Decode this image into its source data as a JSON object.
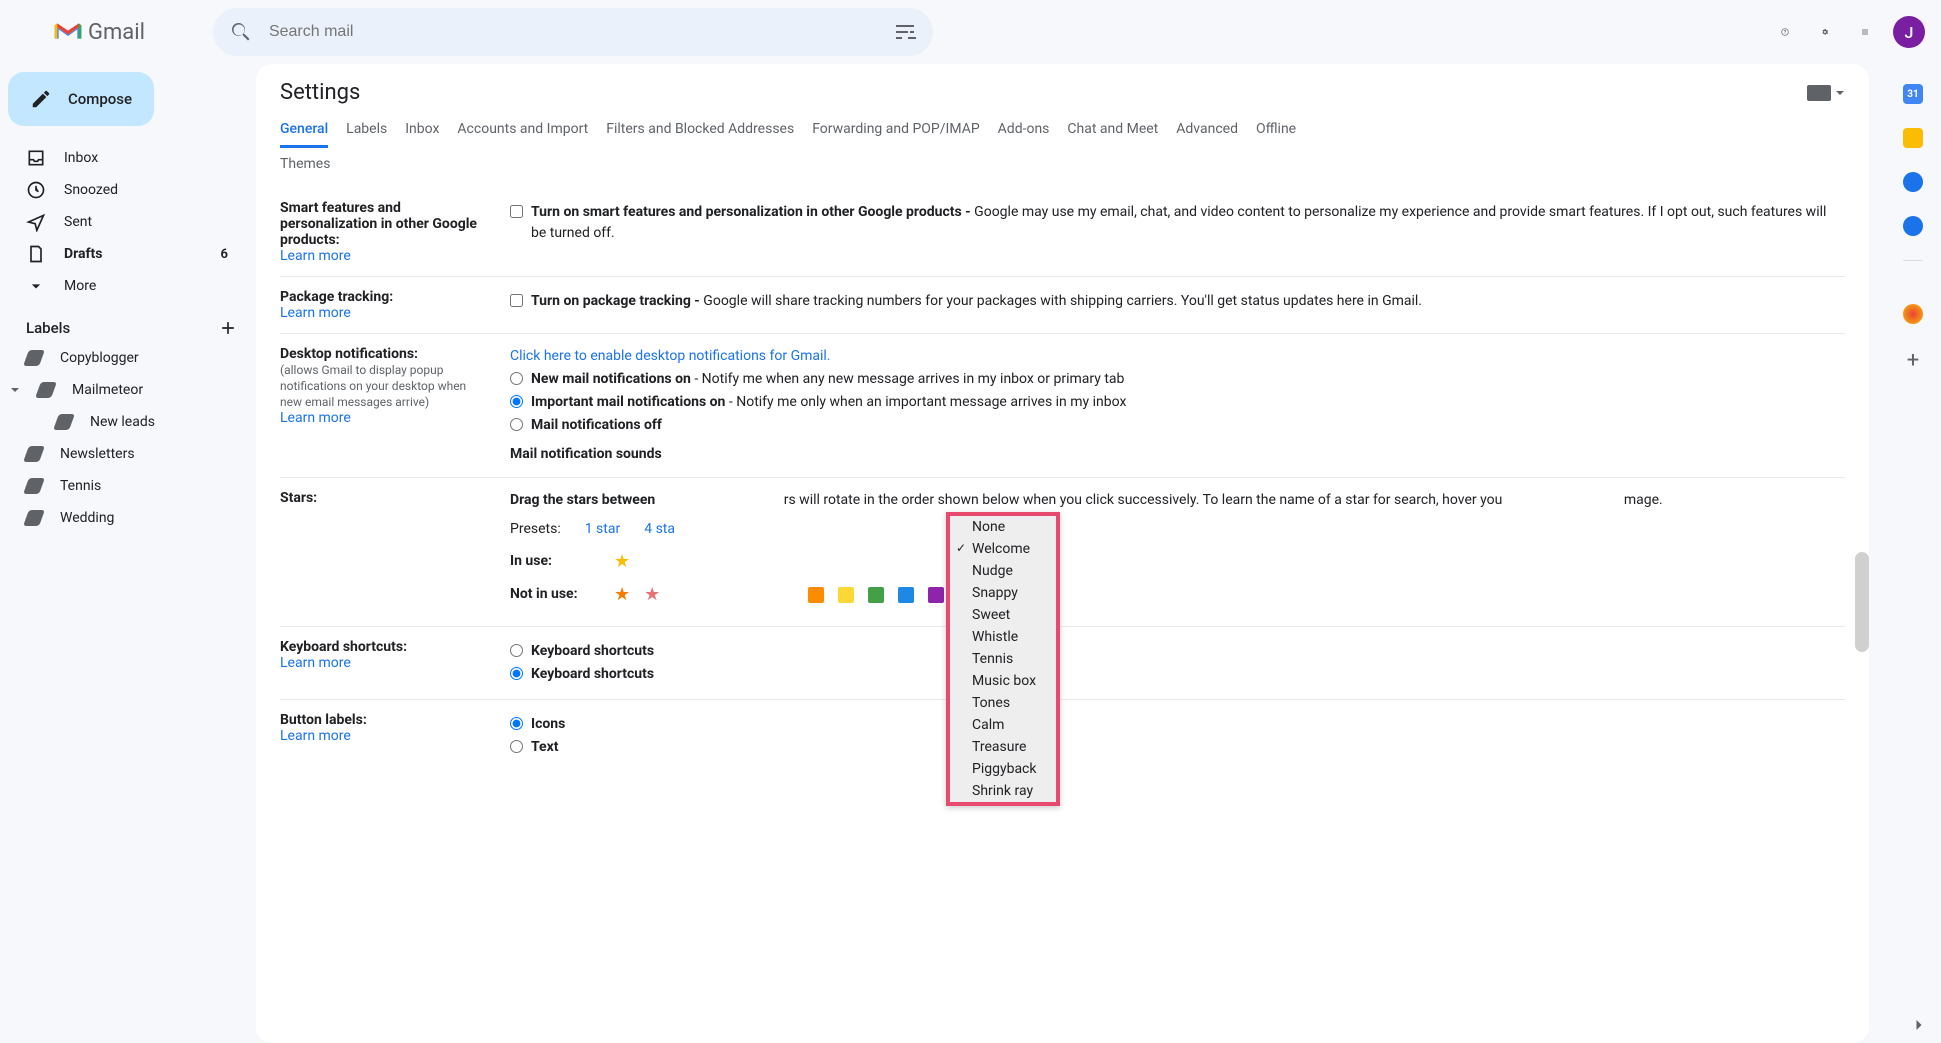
{
  "header": {
    "app_name": "Gmail",
    "search_placeholder": "Search mail",
    "avatar_initial": "J"
  },
  "sidebar": {
    "compose": "Compose",
    "nav": [
      {
        "label": "Inbox"
      },
      {
        "label": "Snoozed"
      },
      {
        "label": "Sent"
      },
      {
        "label": "Drafts",
        "count": "6",
        "bold": true
      },
      {
        "label": "More"
      }
    ],
    "labels_title": "Labels",
    "labels": [
      {
        "label": "Copyblogger"
      },
      {
        "label": "Mailmeteor",
        "caret": true
      },
      {
        "label": "New leads",
        "indent": true
      },
      {
        "label": "Newsletters"
      },
      {
        "label": "Tennis"
      },
      {
        "label": "Wedding"
      }
    ]
  },
  "settings": {
    "title": "Settings",
    "tabs": [
      "General",
      "Labels",
      "Inbox",
      "Accounts and Import",
      "Filters and Blocked Addresses",
      "Forwarding and POP/IMAP",
      "Add-ons",
      "Chat and Meet",
      "Advanced",
      "Offline"
    ],
    "tabs_row2": [
      "Themes"
    ],
    "active_tab": "General",
    "rows": {
      "smart": {
        "title": "Smart features and personalization in other Google products:",
        "learn": "Learn more",
        "bold": "Turn on smart features and personalization in other Google products - ",
        "text": "Google may use my email, chat, and video content to personalize my experience and provide smart features. If I opt out, such features will be turned off."
      },
      "package": {
        "title": "Package tracking:",
        "learn": "Learn more",
        "bold": "Turn on package tracking - ",
        "text": "Google will share tracking numbers for your packages with shipping carriers. You'll get status updates here in Gmail."
      },
      "desktop": {
        "title": "Desktop notifications:",
        "sub": "(allows Gmail to display popup notifications on your desktop when new email messages arrive)",
        "learn": "Learn more",
        "enable_link": "Click here to enable desktop notifications for Gmail.",
        "r1_bold": "New mail notifications on",
        "r1_text": " - Notify me when any new message arrives in my inbox or primary tab",
        "r2_bold": "Important mail notifications on",
        "r2_text": " - Notify me only when an important message arrives in my inbox",
        "r3_bold": "Mail notifications off",
        "sounds_label": "Mail notification sounds"
      },
      "stars": {
        "title": "Stars:",
        "text1_bold": "Drag the stars between",
        "text1_rest": "rs will rotate in the order shown below when you click successively. To learn the name of a star for search, hover you",
        "text1_rest2": "mage.",
        "presets": "Presets:",
        "p1": "1 star",
        "p4": "4 sta",
        "inuse": "In use:",
        "notinuse": "Not in use:"
      },
      "kbd": {
        "title": "Keyboard shortcuts:",
        "learn": "Learn more",
        "r1": "Keyboard shortcuts ",
        "r2": "Keyboard shortcuts "
      },
      "buttons": {
        "title": "Button labels:",
        "learn": "Learn more",
        "r1": "Icons",
        "r2": "Text"
      }
    },
    "sound_options": [
      "None",
      "Welcome",
      "Nudge",
      "Snappy",
      "Sweet",
      "Whistle",
      "Tennis",
      "Music box",
      "Tones",
      "Calm",
      "Treasure",
      "Piggyback",
      "Shrink ray"
    ],
    "sound_selected": "Welcome"
  }
}
